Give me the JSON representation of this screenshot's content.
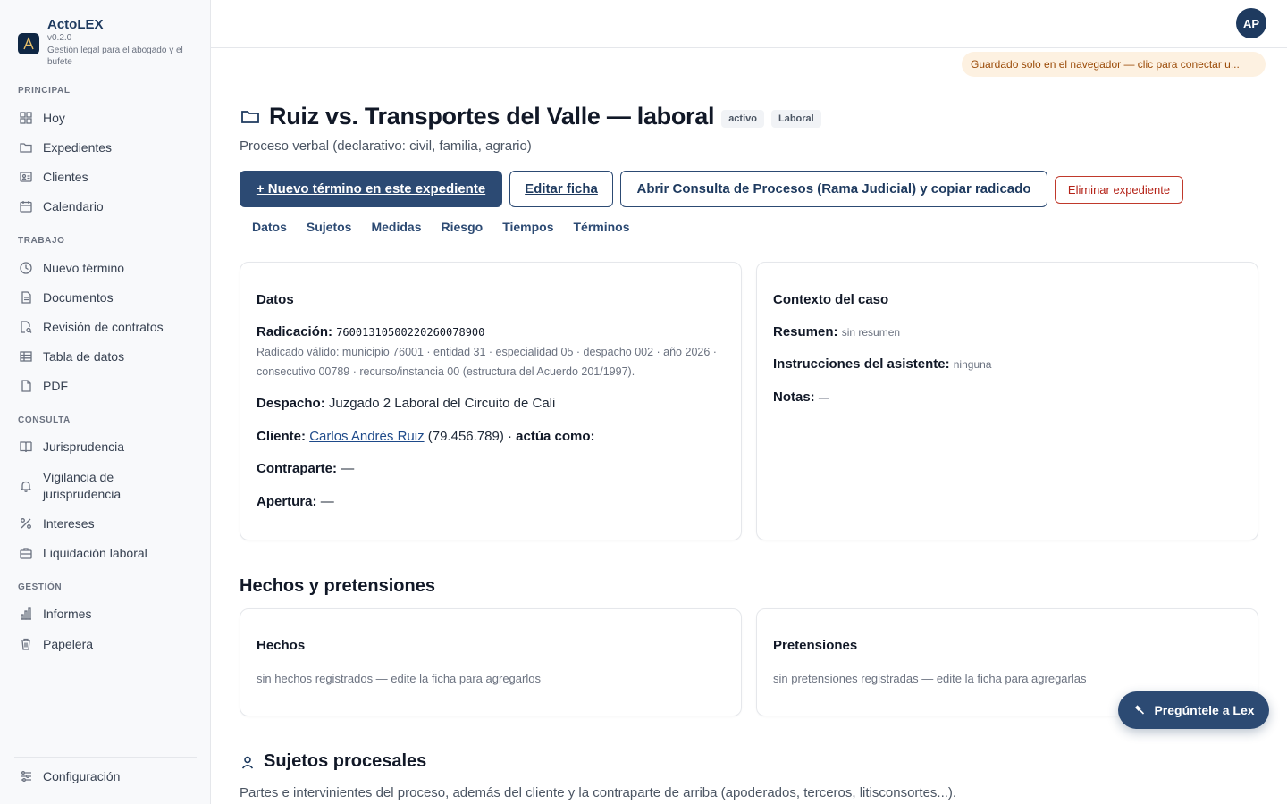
{
  "app": {
    "name": "ActoLEX",
    "version": "v0.2.0",
    "tagline": "Gestión legal para el abogado y el bufete"
  },
  "sidebar": {
    "sections": {
      "principal": "PRINCIPAL",
      "trabajo": "TRABAJO",
      "consulta": "CONSULTA",
      "gestion": "GESTIÓN"
    },
    "items": {
      "hoy": "Hoy",
      "expedientes": "Expedientes",
      "clientes": "Clientes",
      "calendario": "Calendario",
      "nuevo_termino": "Nuevo término",
      "documentos": "Documentos",
      "revision_contratos": "Revisión de contratos",
      "tabla_datos": "Tabla de datos",
      "pdf": "PDF",
      "jurisprudencia": "Jurisprudencia",
      "vigilancia": "Vigilancia de jurisprudencia",
      "intereses": "Intereses",
      "liquidacion": "Liquidación laboral",
      "informes": "Informes",
      "papelera": "Papelera",
      "configuracion": "Configuración"
    }
  },
  "topbar": {
    "avatar_initials": "AP",
    "save_banner": "Guardado solo en el navegador — clic para conectar u..."
  },
  "case": {
    "title": "Ruiz vs. Transportes del Valle — laboral",
    "badges": [
      "activo",
      "Laboral"
    ],
    "subtitle": "Proceso verbal (declarativo: civil, familia, agrario)"
  },
  "actions": {
    "new_term": "+ Nuevo término en este expediente",
    "edit": "Editar ficha",
    "consulta": "Abrir Consulta de Procesos (Rama Judicial) y copiar radicado",
    "delete": "Eliminar expediente"
  },
  "tabs": [
    "Datos",
    "Sujetos",
    "Medidas",
    "Riesgo",
    "Tiempos",
    "Términos"
  ],
  "datos": {
    "title": "Datos",
    "radicacion_label": "Radicación:",
    "radicacion_value": "76001310500220260078900",
    "radicacion_help": "Radicado válido: municipio 76001 · entidad 31 · especialidad 05 · despacho 002 · año 2026 · consecutivo 00789 · recurso/instancia 00 (estructura del Acuerdo 201/1997).",
    "despacho_label": "Despacho:",
    "despacho_value": "Juzgado 2 Laboral del Circuito de Cali",
    "cliente_label": "Cliente:",
    "cliente_name": "Carlos Andrés Ruiz",
    "cliente_id": "(79.456.789) ·",
    "actua_label": "actúa como:",
    "contraparte_label": "Contraparte:",
    "contraparte_value": "—",
    "apertura_label": "Apertura:",
    "apertura_value": "—"
  },
  "contexto": {
    "title": "Contexto del caso",
    "resumen_label": "Resumen:",
    "resumen_value": "sin resumen",
    "instrucciones_label": "Instrucciones del asistente:",
    "instrucciones_value": "ninguna",
    "notas_label": "Notas:",
    "notas_value": "—"
  },
  "hechos_pretensiones": {
    "section_title": "Hechos y pretensiones",
    "hechos_title": "Hechos",
    "hechos_empty": "sin hechos registrados — edite la ficha para agregarlos",
    "pretensiones_title": "Pretensiones",
    "pretensiones_empty": "sin pretensiones registradas — edite la ficha para agregarlas"
  },
  "sujetos": {
    "section_title": "Sujetos procesales",
    "subtitle": "Partes e intervinientes del proceso, además del cliente y la contraparte de arriba (apoderados, terceros, litisconsortes...)."
  },
  "fab": {
    "label": "Pregúntele a Lex"
  }
}
